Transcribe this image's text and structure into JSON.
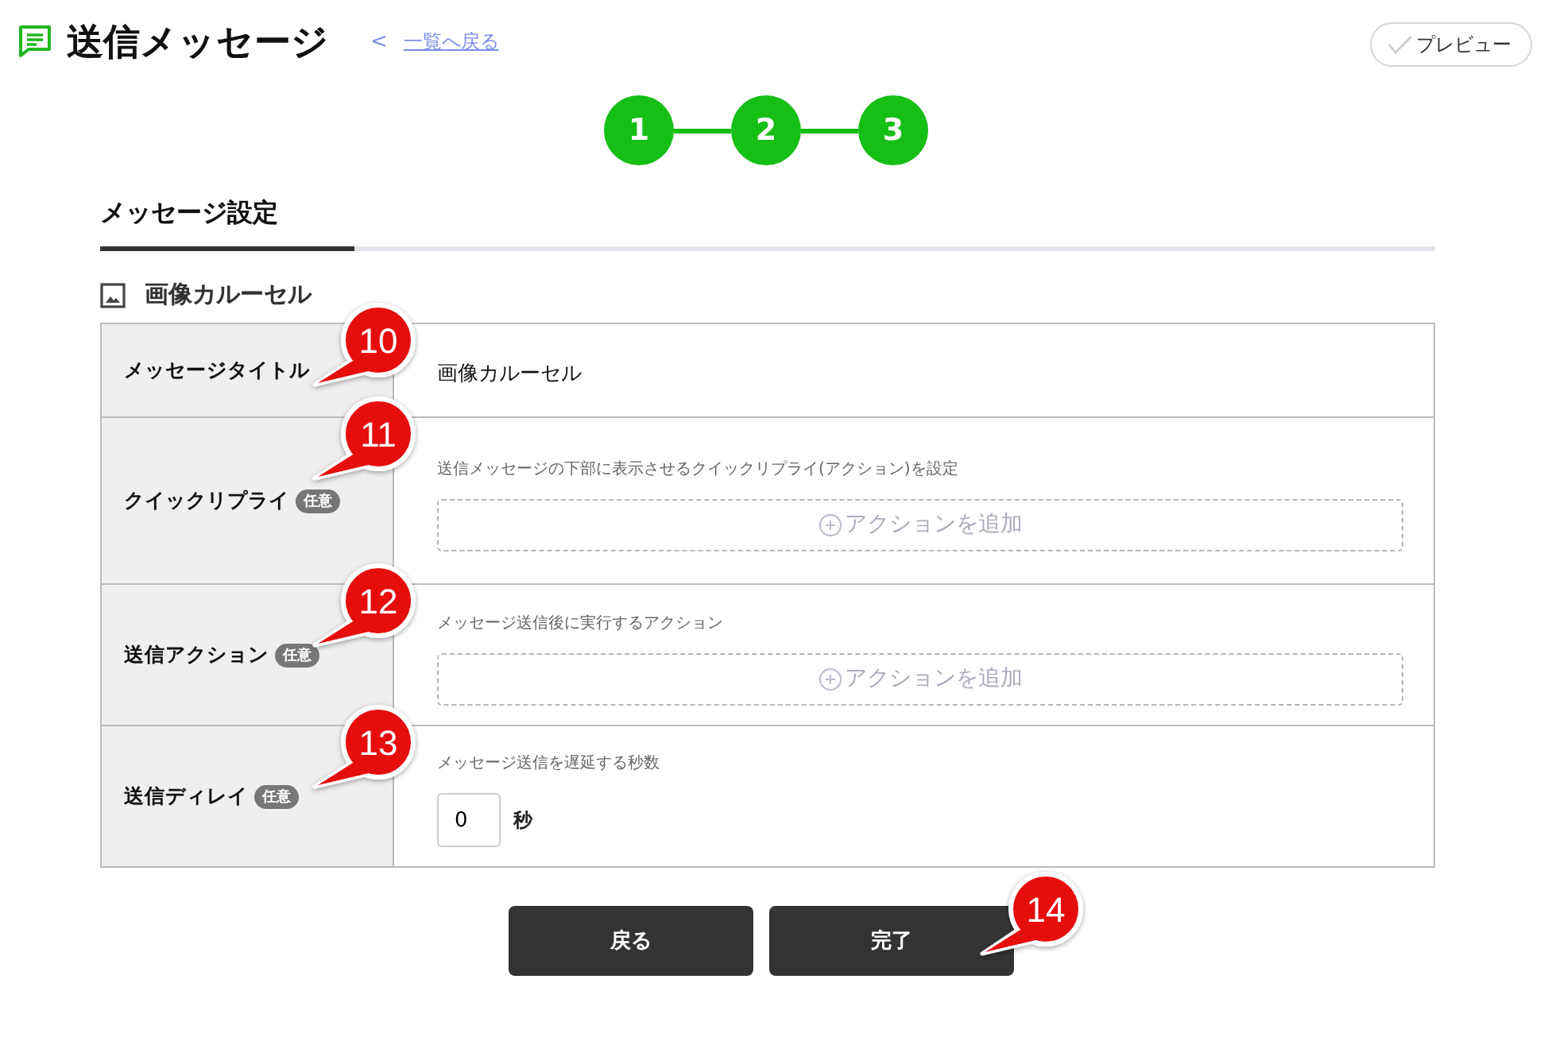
{
  "header": {
    "title": "送信メッセージ",
    "back_arrow": "<",
    "back_link": "一覧へ戻る",
    "preview_button": "プレビュー"
  },
  "steps": [
    {
      "label": "1"
    },
    {
      "label": "2"
    },
    {
      "label": "3"
    }
  ],
  "tabs": [
    {
      "label": "メッセージ設定",
      "selected": true
    }
  ],
  "section": {
    "title": "画像カルーセル"
  },
  "rows": [
    {
      "kind": "text",
      "label": "メッセージタイトル",
      "value": "画像カルーセル",
      "callout": "10"
    },
    {
      "kind": "action",
      "label": "クイックリプライ",
      "badge": "任意",
      "hint": "送信メッセージの下部に表示させるクイックリプライ(アクション)を設定",
      "button": "アクションを追加",
      "callout": "11"
    },
    {
      "kind": "action",
      "label": "送信アクション",
      "badge": "任意",
      "hint": "メッセージ送信後に実行するアクション",
      "button": "アクションを追加",
      "callout": "12"
    },
    {
      "kind": "number",
      "label": "送信ディレイ",
      "badge": "任意",
      "hint": "メッセージ送信を遅延する秒数",
      "value": "0",
      "unit": "秒",
      "callout": "13"
    }
  ],
  "buttons": [
    {
      "label": "戻る"
    },
    {
      "label": "完了",
      "callout": "14"
    }
  ]
}
